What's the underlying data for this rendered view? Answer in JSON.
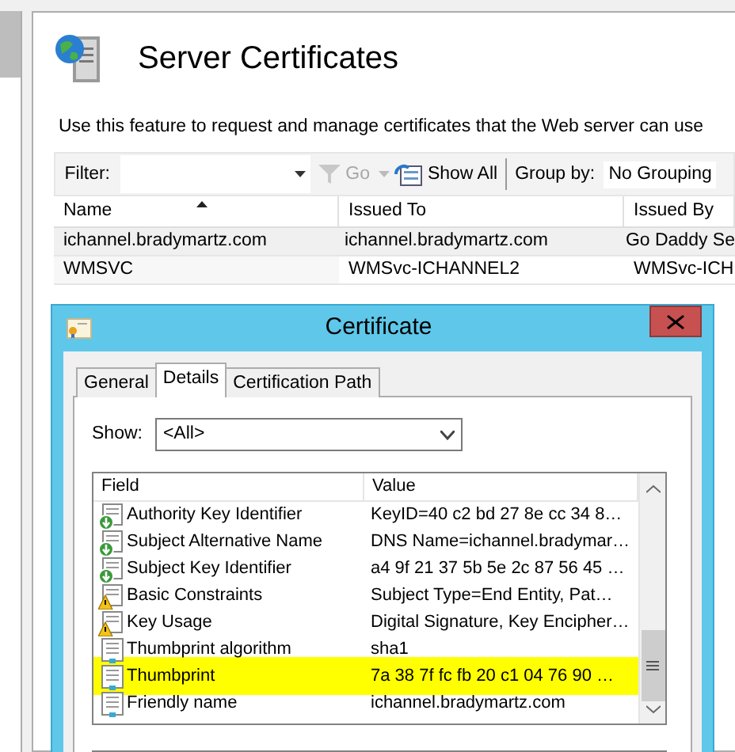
{
  "feature_page": {
    "title": "Server Certificates",
    "description": "Use this feature to request and manage certificates that the Web server can use",
    "toolbar": {
      "filter_label": "Filter:",
      "go_label": "Go",
      "show_all_label": "Show All",
      "group_by_label": "Group by:",
      "group_by_value": "No Grouping"
    },
    "table": {
      "columns": [
        {
          "label": "Name",
          "sorted": true
        },
        {
          "label": "Issued To",
          "sorted": false
        },
        {
          "label": "Issued By",
          "sorted": false
        }
      ],
      "rows": [
        {
          "cells": [
            "ichannel.bradymartz.com",
            "ichannel.bradymartz.com",
            "Go Daddy Se"
          ],
          "selected": true
        },
        {
          "cells": [
            "WMSVC",
            "WMSvc-ICHANNEL2",
            "WMSvc-ICH"
          ],
          "selected": false
        }
      ]
    }
  },
  "dialog": {
    "title": "Certificate",
    "tabs": [
      {
        "label": "General",
        "selected": false
      },
      {
        "label": "Details",
        "selected": true
      },
      {
        "label": "Certification Path",
        "selected": false
      }
    ],
    "show_label": "Show:",
    "show_value": "<All>",
    "columns": [
      "Field",
      "Value"
    ],
    "fields": [
      {
        "kind": "extension",
        "field": "Authority Key Identifier",
        "value": "KeyID=40 c2 bd 27 8e cc 34 8…",
        "highlighted": false
      },
      {
        "kind": "extension",
        "field": "Subject Alternative Name",
        "value": "DNS Name=ichannel.bradymar…",
        "highlighted": false
      },
      {
        "kind": "extension",
        "field": "Subject Key Identifier",
        "value": "a4 9f 21 37 5b 5e 2c 87 56 45 …",
        "highlighted": false
      },
      {
        "kind": "critical",
        "field": "Basic Constraints",
        "value": "Subject Type=End Entity, Pat…",
        "highlighted": false
      },
      {
        "kind": "critical",
        "field": "Key Usage",
        "value": "Digital Signature, Key Encipher…",
        "highlighted": false
      },
      {
        "kind": "property",
        "field": "Thumbprint algorithm",
        "value": "sha1",
        "highlighted": false
      },
      {
        "kind": "property",
        "field": "Thumbprint",
        "value": "7a 38 7f fc fb 20 c1 04 76 90 …",
        "highlighted": true
      },
      {
        "kind": "property",
        "field": "Friendly name",
        "value": "ichannel.bradymartz.com",
        "highlighted": false
      }
    ]
  }
}
